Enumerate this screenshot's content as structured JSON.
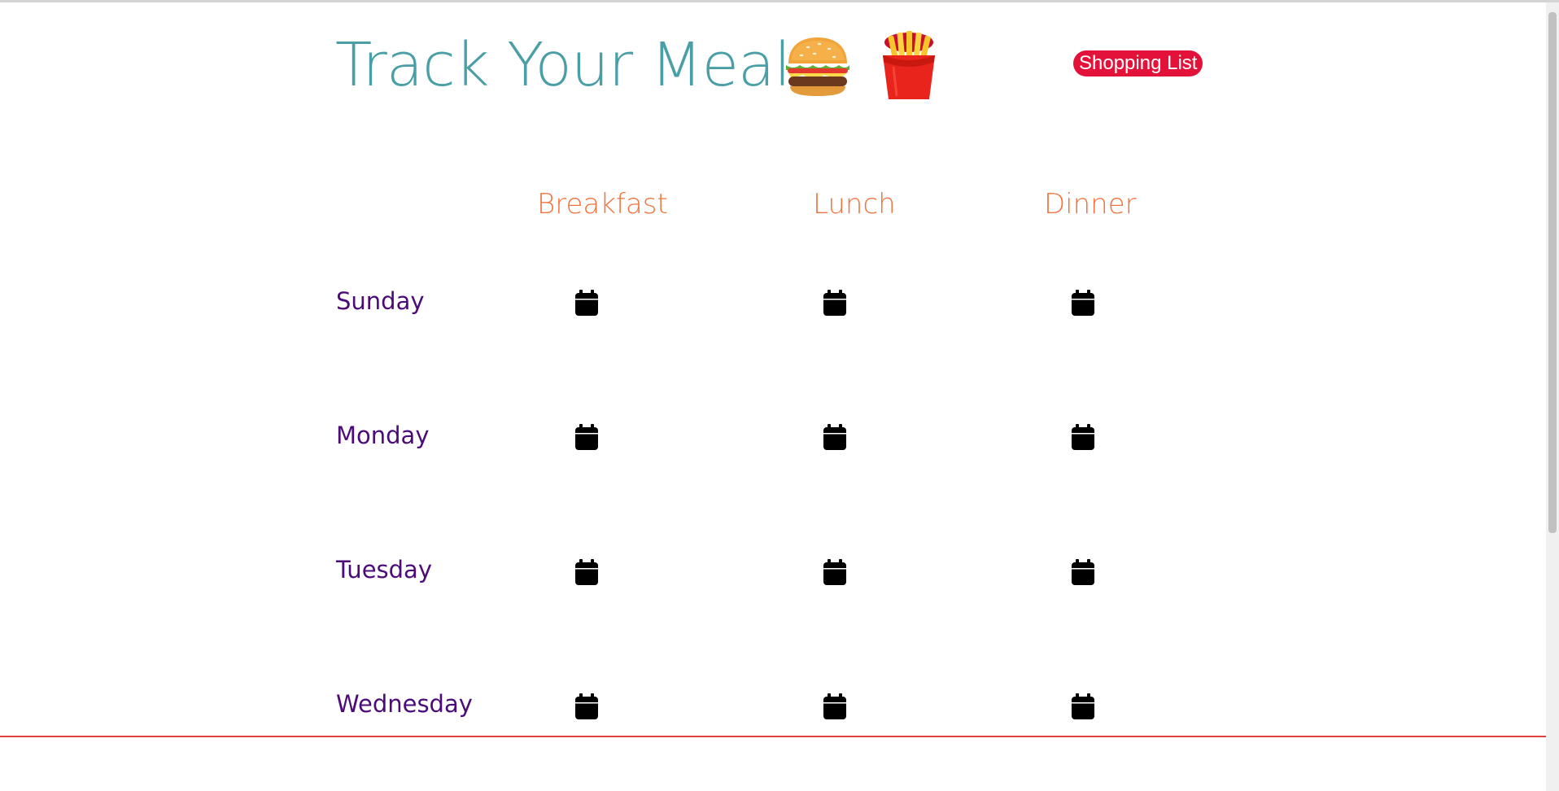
{
  "header": {
    "title": "Track Your Meal",
    "emojis": [
      "burger",
      "fries"
    ],
    "shopping_list_label": "Shopping List"
  },
  "planner": {
    "meals": [
      {
        "label": "Breakfast"
      },
      {
        "label": "Lunch"
      },
      {
        "label": "Dinner"
      }
    ],
    "days": [
      {
        "label": "Sunday"
      },
      {
        "label": "Monday"
      },
      {
        "label": "Tuesday"
      },
      {
        "label": "Wednesday"
      }
    ],
    "cell_icon": "calendar-icon"
  },
  "colors": {
    "title": "#4a9fa6",
    "meal_header": "#f2733e",
    "day_label": "#4b0b78",
    "shopping_button": "#e3123a",
    "divider": "#e0413c"
  }
}
